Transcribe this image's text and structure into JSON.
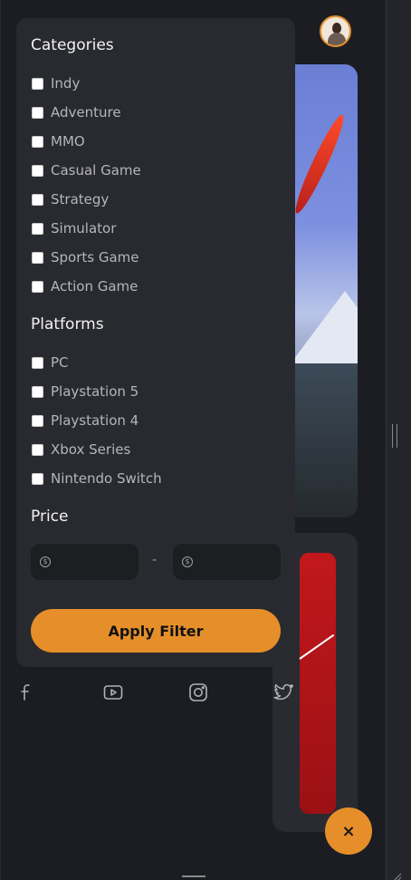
{
  "filter": {
    "categories_title": "Categories",
    "categories": [
      "Indy",
      "Adventure",
      "MMO",
      "Casual Game",
      "Strategy",
      "Simulator",
      "Sports Game",
      "Action Game"
    ],
    "platforms_title": "Platforms",
    "platforms": [
      "PC",
      "Playstation 5",
      "Playstation 4",
      "Xbox Series",
      "Nintendo Switch"
    ],
    "price_title": "Price",
    "price_separator": "-",
    "price_min_value": "",
    "price_max_value": "",
    "apply_label": "Apply Filter"
  },
  "social_icons": [
    "facebook-icon",
    "youtube-icon",
    "instagram-icon",
    "twitter-icon"
  ],
  "fab": {
    "icon": "close-icon",
    "label": "×"
  },
  "colors": {
    "accent": "#e68f2a",
    "panel": "#292a2f",
    "background": "#1c1d22"
  }
}
